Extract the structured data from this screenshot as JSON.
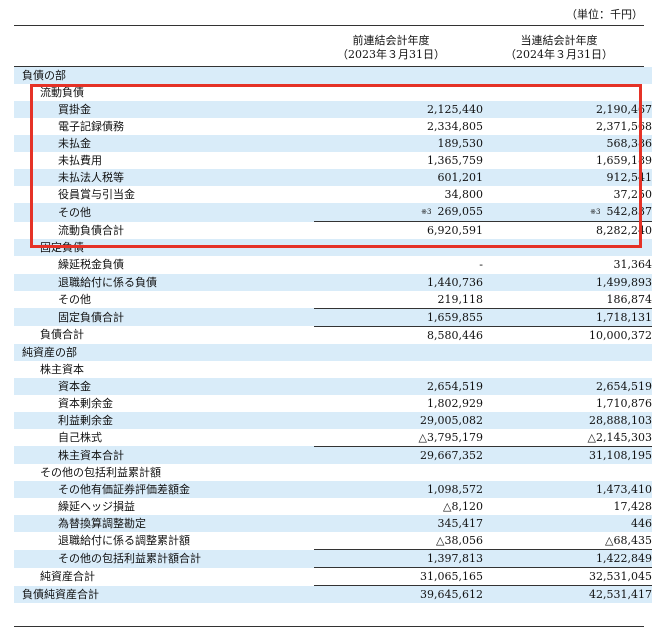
{
  "unit": "（単位：千円）",
  "columns": [
    {
      "line1": "前連結会計年度",
      "line2": "（2023年３月31日）"
    },
    {
      "line1": "当連結会計年度",
      "line2": "（2024年３月31日）"
    }
  ],
  "rows": [
    {
      "label": "負債の部",
      "indent": 0,
      "prev": "",
      "curr": ""
    },
    {
      "label": "流動負債",
      "indent": 1,
      "prev": "",
      "curr": ""
    },
    {
      "label": "買掛金",
      "indent": 2,
      "prev": "2,125,440",
      "curr": "2,190,467"
    },
    {
      "label": "電子記録債務",
      "indent": 2,
      "prev": "2,334,805",
      "curr": "2,371,568"
    },
    {
      "label": "未払金",
      "indent": 2,
      "prev": "189,530",
      "curr": "568,386"
    },
    {
      "label": "未払費用",
      "indent": 2,
      "prev": "1,365,759",
      "curr": "1,659,189"
    },
    {
      "label": "未払法人税等",
      "indent": 2,
      "prev": "601,201",
      "curr": "912,541"
    },
    {
      "label": "役員賞与引当金",
      "indent": 2,
      "prev": "34,800",
      "curr": "37,250"
    },
    {
      "label": "その他",
      "indent": 2,
      "prev": "269,055",
      "curr": "542,837",
      "prev_note": "※3",
      "curr_note": "※3",
      "underline": true
    },
    {
      "label": "流動負債合計",
      "indent": 2,
      "prev": "6,920,591",
      "curr": "8,282,240"
    },
    {
      "label": "固定負債",
      "indent": 1,
      "prev": "",
      "curr": ""
    },
    {
      "label": "繰延税金負債",
      "indent": 2,
      "prev": "-",
      "curr": "31,364"
    },
    {
      "label": "退職給付に係る負債",
      "indent": 2,
      "prev": "1,440,736",
      "curr": "1,499,893"
    },
    {
      "label": "その他",
      "indent": 2,
      "prev": "219,118",
      "curr": "186,874",
      "underline": true
    },
    {
      "label": "固定負債合計",
      "indent": 2,
      "prev": "1,659,855",
      "curr": "1,718,131",
      "underline": true
    },
    {
      "label": "負債合計",
      "indent": 1,
      "prev": "8,580,446",
      "curr": "10,000,372"
    },
    {
      "label": "純資産の部",
      "indent": 0,
      "prev": "",
      "curr": ""
    },
    {
      "label": "株主資本",
      "indent": 1,
      "prev": "",
      "curr": ""
    },
    {
      "label": "資本金",
      "indent": 2,
      "prev": "2,654,519",
      "curr": "2,654,519"
    },
    {
      "label": "資本剰余金",
      "indent": 2,
      "prev": "1,802,929",
      "curr": "1,710,876"
    },
    {
      "label": "利益剰余金",
      "indent": 2,
      "prev": "29,005,082",
      "curr": "28,888,103"
    },
    {
      "label": "自己株式",
      "indent": 2,
      "prev": "△3,795,179",
      "curr": "△2,145,303",
      "underline": true
    },
    {
      "label": "株主資本合計",
      "indent": 2,
      "prev": "29,667,352",
      "curr": "31,108,195"
    },
    {
      "label": "その他の包括利益累計額",
      "indent": 1,
      "prev": "",
      "curr": ""
    },
    {
      "label": "その他有価証券評価差額金",
      "indent": 2,
      "prev": "1,098,572",
      "curr": "1,473,410"
    },
    {
      "label": "繰延ヘッジ損益",
      "indent": 2,
      "prev": "△8,120",
      "curr": "17,428"
    },
    {
      "label": "為替換算調整勘定",
      "indent": 2,
      "prev": "345,417",
      "curr": "446"
    },
    {
      "label": "退職給付に係る調整累計額",
      "indent": 2,
      "prev": "△38,056",
      "curr": "△68,435",
      "underline": true
    },
    {
      "label": "その他の包括利益累計額合計",
      "indent": 2,
      "prev": "1,397,813",
      "curr": "1,422,849",
      "underline": true
    },
    {
      "label": "純資産合計",
      "indent": 1,
      "prev": "31,065,165",
      "curr": "32,531,045",
      "underline": true
    },
    {
      "label": "負債純資産合計",
      "indent": 0,
      "prev": "39,645,612",
      "curr": "42,531,417"
    }
  ],
  "highlight_color": "#e53227"
}
